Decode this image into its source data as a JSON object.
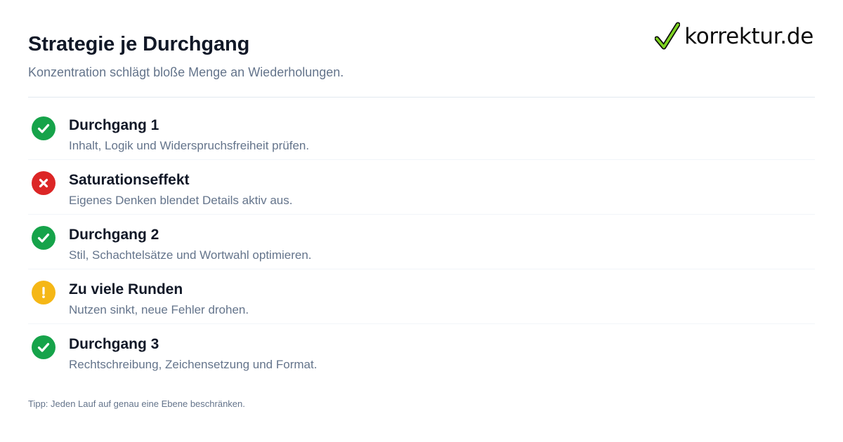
{
  "header": {
    "title": "Strategie je Durchgang",
    "subtitle": "Konzentration schlägt bloße Menge an Wiederholungen."
  },
  "logo": {
    "text": "korrektur.de",
    "icon": "checkmark-icon",
    "check_color": "#7ed321"
  },
  "items": [
    {
      "status": "success",
      "icon": "check-circle-icon",
      "title": "Durchgang 1",
      "description": "Inhalt, Logik und Widerspruchsfreiheit prüfen."
    },
    {
      "status": "error",
      "icon": "x-circle-icon",
      "title": "Saturationseffekt",
      "description": "Eigenes Denken blendet Details aktiv aus."
    },
    {
      "status": "success",
      "icon": "check-circle-icon",
      "title": "Durchgang 2",
      "description": "Stil, Schachtelsätze und Wortwahl optimieren."
    },
    {
      "status": "warning",
      "icon": "exclamation-circle-icon",
      "title": "Zu viele Runden",
      "description": "Nutzen sinkt, neue Fehler drohen."
    },
    {
      "status": "success",
      "icon": "check-circle-icon",
      "title": "Durchgang 3",
      "description": "Rechtschreibung, Zeichensetzung und Format."
    }
  ],
  "footer": {
    "tip": "Tipp: Jeden Lauf auf genau eine Ebene beschränken."
  },
  "colors": {
    "success": "#16a34a",
    "error": "#dc2626",
    "warning": "#f5b716",
    "title_text": "#111827",
    "muted_text": "#64748b"
  }
}
